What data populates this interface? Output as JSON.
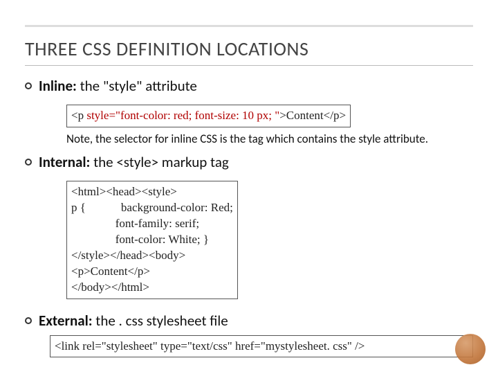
{
  "title": "THREE CSS DEFINITION LOCATIONS",
  "bullet1": {
    "label": "Inline:",
    "desc": "the \"style\" attribute",
    "code_pre": "<p ",
    "code_red": "style=\"font-color: red; font-size: 10 px; \"",
    "code_post": ">Content</p>",
    "note": "Note, the selector for inline CSS is the tag which contains the style attribute."
  },
  "bullet2": {
    "label": "Internal:",
    "desc": "the <style> markup tag",
    "code": "<html><head><style>\np {            background-color: Red;\n               font-family: serif;\n               font-color: White; }\n</style></head><body>\n<p>Content</p>\n</body></html>"
  },
  "bullet3": {
    "label": "External:",
    "desc": "the . css stylesheet file",
    "code": "<link rel=\"stylesheet\" type=\"text/css\" href=\"mystylesheet. css\" />"
  }
}
